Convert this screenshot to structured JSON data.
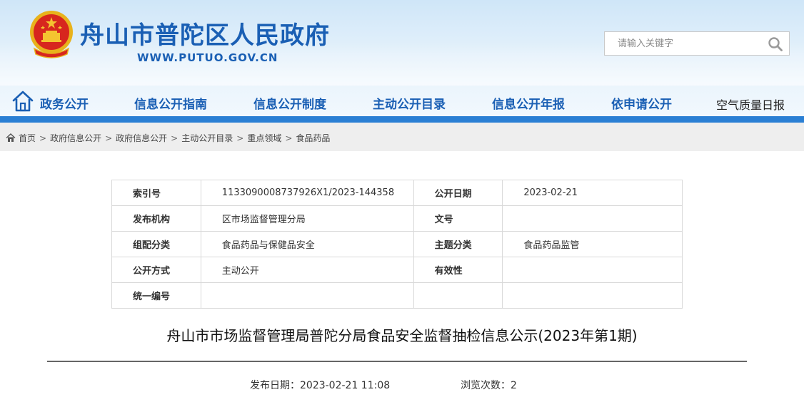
{
  "header": {
    "site_title": "舟山市普陀区人民政府",
    "site_url": "WWW.PUTUO.GOV.CN",
    "search_placeholder": "请输入关键字",
    "emblem_icon": "national-emblem-icon",
    "search_icon": "search-icon"
  },
  "nav": {
    "items": [
      {
        "label": "政务公开"
      },
      {
        "label": "信息公开指南"
      },
      {
        "label": "信息公开制度"
      },
      {
        "label": "主动公开目录"
      },
      {
        "label": "信息公开年报"
      },
      {
        "label": "依申请公开"
      },
      {
        "label": "空气质量日报"
      }
    ],
    "home_icon": "home-icon"
  },
  "breadcrumb": {
    "items": [
      "首页",
      "政府信息公开",
      "政府信息公开",
      "主动公开目录",
      "重点领域",
      "食品药品"
    ],
    "separator": ">"
  },
  "info_table": {
    "rows": [
      {
        "k1": "索引号",
        "v1": "1133090008737926X1/2023-144358",
        "k2": "公开日期",
        "v2": "2023-02-21"
      },
      {
        "k1": "发布机构",
        "v1": "区市场监督管理分局",
        "k2": "文号",
        "v2": ""
      },
      {
        "k1": "组配分类",
        "v1": "食品药品与保健品安全",
        "k2": "主题分类",
        "v2": "食品药品监管"
      },
      {
        "k1": "公开方式",
        "v1": "主动公开",
        "k2": "有效性",
        "v2": ""
      },
      {
        "k1": "统一编号",
        "v1": "",
        "k2": "",
        "v2": ""
      }
    ]
  },
  "article": {
    "title": "舟山市市场监督管理局普陀分局食品安全监督抽检信息公示(2023年第1期)",
    "publish_date": "发布日期：2023-02-21 11:08",
    "views": "浏览次数：2"
  },
  "colors": {
    "brand_blue": "#1a5fb4",
    "nav_bar": "#2a7fd4",
    "breadcrumb_bg": "#eeeeee",
    "emblem_red": "#d7261e",
    "emblem_gold": "#f4c430"
  }
}
